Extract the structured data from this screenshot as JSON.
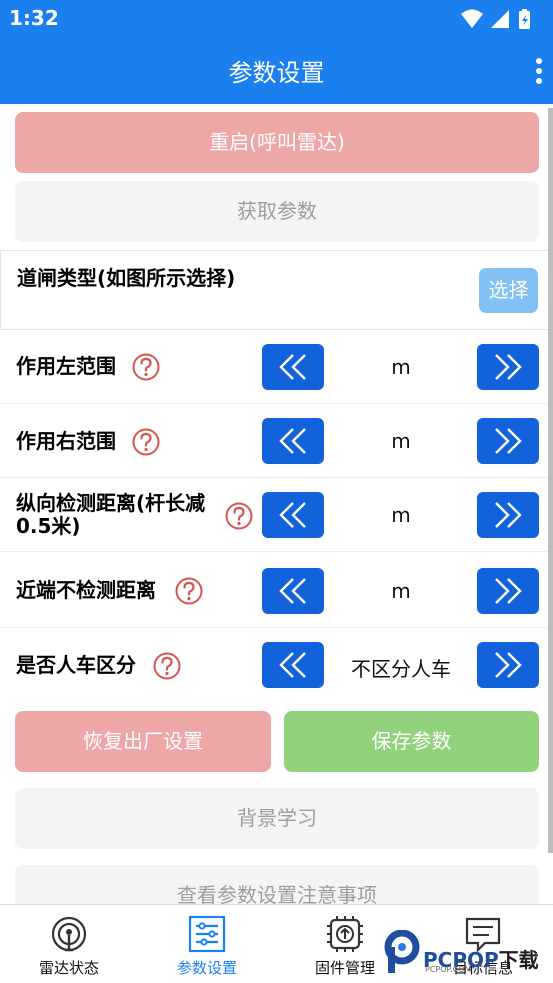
{
  "status_bar": {
    "time": "1:32"
  },
  "app_bar": {
    "title": "参数设置"
  },
  "buttons": {
    "restart": "重启(呼叫雷达)",
    "get_params": "获取参数",
    "select": "选择",
    "reset_factory": "恢复出厂设置",
    "save_params": "保存参数",
    "background_learning": "背景学习",
    "view_notes": "查看参数设置注意事项"
  },
  "gate_type": {
    "label": "道闸类型(如图所示选择)"
  },
  "params": [
    {
      "label": "作用左范围",
      "value": "m"
    },
    {
      "label": "作用右范围",
      "value": "m"
    },
    {
      "label": "纵向检测距离(杆长减0.5米)",
      "value": "m"
    },
    {
      "label": "近端不检测距离",
      "value": "m"
    },
    {
      "label": "是否人车区分",
      "value": "不区分人车"
    }
  ],
  "bottom_nav": [
    {
      "label": "雷达状态",
      "icon": "radar-icon",
      "active": false
    },
    {
      "label": "参数设置",
      "icon": "sliders-icon",
      "active": true
    },
    {
      "label": "固件管理",
      "icon": "chip-upload-icon",
      "active": false
    },
    {
      "label": "目标信息",
      "icon": "message-icon",
      "active": false
    }
  ],
  "watermark": {
    "brand": "PCPOP",
    "suffix": "下载",
    "sub": "PCPOP.COM"
  },
  "colors": {
    "primary": "#1a80f0",
    "arrow_button": "#1262dc",
    "restart_button": "#eda7a7",
    "save_button": "#92d27d",
    "select_button": "#82c0f5",
    "disabled_button": "#f4f4f4",
    "help_icon": "#d9534f"
  }
}
